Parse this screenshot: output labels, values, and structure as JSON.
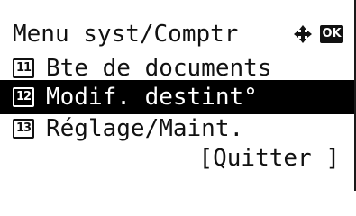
{
  "header": {
    "title": "Menu syst/Comptr",
    "ok_label": "OK"
  },
  "menu": {
    "items": [
      {
        "number": "11",
        "label": "Bte de documents"
      },
      {
        "number": "12",
        "label": "Modif. destint°"
      },
      {
        "number": "13",
        "label": "Réglage/Maint."
      }
    ],
    "quit_label": "[Quitter ]"
  },
  "colors": {
    "background": "#ffffff",
    "text": "#111111",
    "selection_background": "#000000",
    "selection_text": "#ffffff"
  },
  "icons": {
    "navigation": "dpad-arrows-icon",
    "confirm": "ok-key-icon"
  }
}
